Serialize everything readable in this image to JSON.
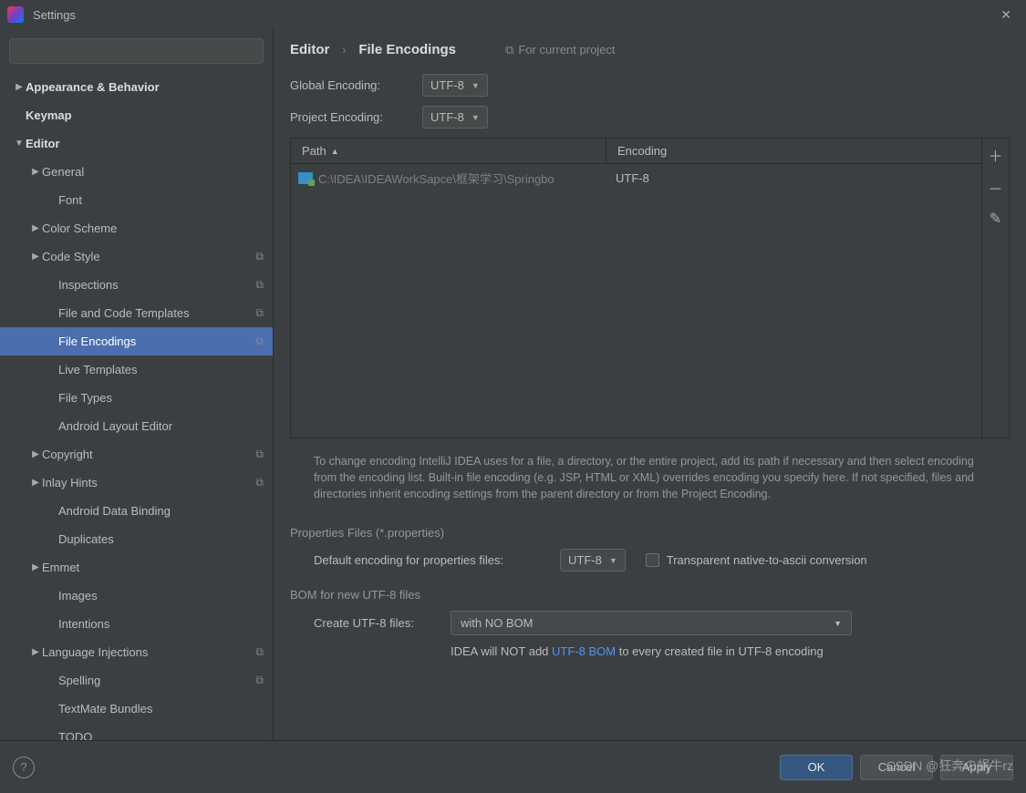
{
  "window": {
    "title": "Settings"
  },
  "search": {
    "placeholder": ""
  },
  "tree": [
    {
      "label": "Appearance & Behavior",
      "indent": 0,
      "arrow": "right",
      "bold": true
    },
    {
      "label": "Keymap",
      "indent": 0,
      "arrow": "none",
      "bold": true
    },
    {
      "label": "Editor",
      "indent": 0,
      "arrow": "down",
      "bold": true
    },
    {
      "label": "General",
      "indent": 1,
      "arrow": "right"
    },
    {
      "label": "Font",
      "indent": 2,
      "arrow": "none"
    },
    {
      "label": "Color Scheme",
      "indent": 1,
      "arrow": "right"
    },
    {
      "label": "Code Style",
      "indent": 1,
      "arrow": "right",
      "copy": true
    },
    {
      "label": "Inspections",
      "indent": 2,
      "arrow": "none",
      "copy": true
    },
    {
      "label": "File and Code Templates",
      "indent": 2,
      "arrow": "none",
      "copy": true
    },
    {
      "label": "File Encodings",
      "indent": 2,
      "arrow": "none",
      "copy": true,
      "selected": true
    },
    {
      "label": "Live Templates",
      "indent": 2,
      "arrow": "none"
    },
    {
      "label": "File Types",
      "indent": 2,
      "arrow": "none"
    },
    {
      "label": "Android Layout Editor",
      "indent": 2,
      "arrow": "none"
    },
    {
      "label": "Copyright",
      "indent": 1,
      "arrow": "right",
      "copy": true
    },
    {
      "label": "Inlay Hints",
      "indent": 1,
      "arrow": "right",
      "copy": true
    },
    {
      "label": "Android Data Binding",
      "indent": 2,
      "arrow": "none"
    },
    {
      "label": "Duplicates",
      "indent": 2,
      "arrow": "none"
    },
    {
      "label": "Emmet",
      "indent": 1,
      "arrow": "right"
    },
    {
      "label": "Images",
      "indent": 2,
      "arrow": "none"
    },
    {
      "label": "Intentions",
      "indent": 2,
      "arrow": "none"
    },
    {
      "label": "Language Injections",
      "indent": 1,
      "arrow": "right",
      "copy": true
    },
    {
      "label": "Spelling",
      "indent": 2,
      "arrow": "none",
      "copy": true
    },
    {
      "label": "TextMate Bundles",
      "indent": 2,
      "arrow": "none"
    },
    {
      "label": "TODO",
      "indent": 2,
      "arrow": "none"
    }
  ],
  "breadcrumb": {
    "root": "Editor",
    "page": "File Encodings",
    "scope": "For current project"
  },
  "globalEncoding": {
    "label": "Global Encoding:",
    "value": "UTF-8"
  },
  "projectEncoding": {
    "label": "Project Encoding:",
    "value": "UTF-8"
  },
  "table": {
    "col_path": "Path",
    "col_enc": "Encoding",
    "rows": [
      {
        "path": "C:\\IDEA\\IDEAWorkSapce\\框架学习\\Springbo",
        "encoding": "UTF-8"
      }
    ]
  },
  "help_text": "To change encoding IntelliJ IDEA uses for a file, a directory, or the entire project, add its path if necessary and then select encoding from the encoding list. Built-in file encoding (e.g. JSP, HTML or XML) overrides encoding you specify here. If not specified, files and directories inherit encoding settings from the parent directory or from the Project Encoding.",
  "properties": {
    "section": "Properties Files (*.properties)",
    "default_label": "Default encoding for properties files:",
    "default_value": "UTF-8",
    "transparent_label": "Transparent native-to-ascii conversion"
  },
  "bom": {
    "section": "BOM for new UTF-8 files",
    "create_label": "Create UTF-8 files:",
    "create_value": "with NO BOM",
    "hint_pre": "IDEA will NOT add ",
    "hint_link": "UTF-8 BOM",
    "hint_post": " to every created file in UTF-8 encoding"
  },
  "footer": {
    "ok": "OK",
    "cancel": "Cancel",
    "apply": "Apply"
  },
  "watermark": "CSDN @狂奔の蜗牛rz"
}
